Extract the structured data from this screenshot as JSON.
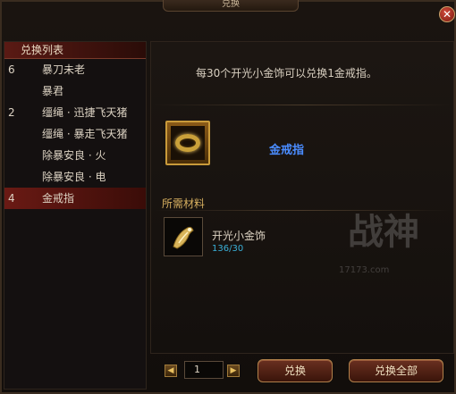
{
  "window": {
    "title": "兑换",
    "close_icon": "close-icon"
  },
  "list": {
    "header": "兑换列表",
    "items": [
      {
        "num": "6",
        "label": "暴刀未老"
      },
      {
        "num": "",
        "label": "暴君"
      },
      {
        "num": "2",
        "label": "缰绳 · 迅捷飞天猪"
      },
      {
        "num": "",
        "label": "缰绳 · 暴走飞天猪"
      },
      {
        "num": "",
        "label": "除暴安良 · 火"
      },
      {
        "num": "",
        "label": "除暴安良 · 电"
      },
      {
        "num": "4",
        "label": "金戒指"
      }
    ],
    "selected_index": 6
  },
  "detail": {
    "info": "每30个开光小金饰可以兑换1金戒指。",
    "target_name": "金戒指",
    "target_icon": "gold-ring-icon",
    "materials_header": "所需材料",
    "material_name": "开光小金饰",
    "material_count": "136/30",
    "material_icon": "gold-ornament-icon"
  },
  "watermark": {
    "text": "战神",
    "subtext": "17173.com"
  },
  "pager": {
    "value": "1",
    "prev_icon": "arrow-left-icon",
    "next_icon": "arrow-right-icon"
  },
  "actions": {
    "exchange_label": "兑换",
    "exchange_all_label": "兑换全部"
  },
  "colors": {
    "accent_red": "#6a1a14",
    "target_name": "#4a8cff",
    "materials_header": "#d8b060",
    "count": "#3ab0d8"
  }
}
